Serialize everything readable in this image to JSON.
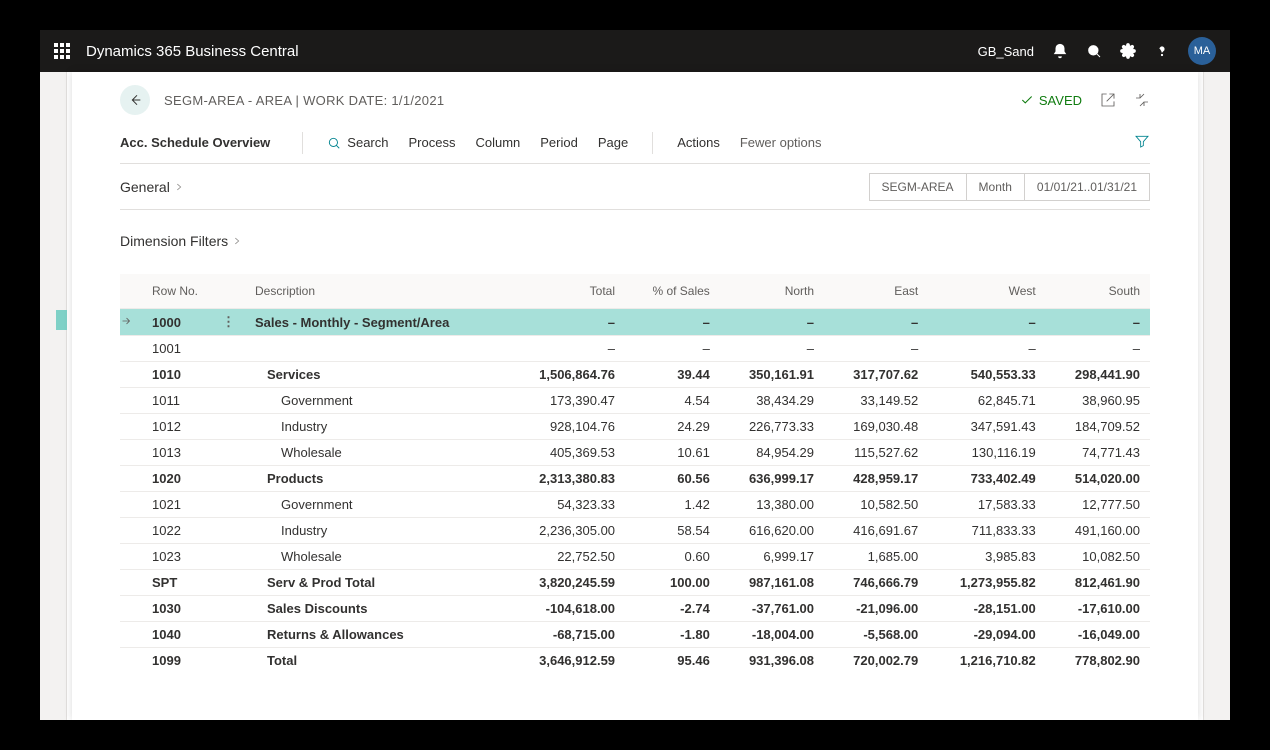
{
  "topbar": {
    "app_name": "Dynamics 365 Business Central",
    "tenant": "GB_Sand",
    "avatar_initials": "MA"
  },
  "page": {
    "title": "SEGM-AREA - AREA | WORK DATE: 1/1/2021",
    "saved_label": "SAVED"
  },
  "toolbar": {
    "title": "Acc. Schedule Overview",
    "search": "Search",
    "process": "Process",
    "column": "Column",
    "period": "Period",
    "page": "Page",
    "actions": "Actions",
    "fewer": "Fewer options"
  },
  "sections": {
    "general": "General",
    "dimension_filters": "Dimension Filters"
  },
  "chips": {
    "segm": "SEGM-AREA",
    "period": "Month",
    "range": "01/01/21..01/31/21"
  },
  "table": {
    "headers": {
      "rowno": "Row No.",
      "desc": "Description",
      "total": "Total",
      "pct": "% of Sales",
      "north": "North",
      "east": "East",
      "west": "West",
      "south": "South"
    },
    "rows": [
      {
        "rowno": "1000",
        "desc": "Sales - Monthly - Segment/Area",
        "total": "–",
        "pct": "–",
        "north": "–",
        "east": "–",
        "west": "–",
        "south": "–",
        "bold": true,
        "indent": 0,
        "selected": true,
        "arrow": true
      },
      {
        "rowno": "1001",
        "desc": "",
        "total": "–",
        "pct": "–",
        "north": "–",
        "east": "–",
        "west": "–",
        "south": "–",
        "bold": false,
        "indent": 0
      },
      {
        "rowno": "1010",
        "desc": "Services",
        "total": "1,506,864.76",
        "pct": "39.44",
        "north": "350,161.91",
        "east": "317,707.62",
        "west": "540,553.33",
        "south": "298,441.90",
        "bold": true,
        "indent": 1
      },
      {
        "rowno": "1011",
        "desc": "Government",
        "total": "173,390.47",
        "pct": "4.54",
        "north": "38,434.29",
        "east": "33,149.52",
        "west": "62,845.71",
        "south": "38,960.95",
        "bold": false,
        "indent": 2
      },
      {
        "rowno": "1012",
        "desc": "Industry",
        "total": "928,104.76",
        "pct": "24.29",
        "north": "226,773.33",
        "east": "169,030.48",
        "west": "347,591.43",
        "south": "184,709.52",
        "bold": false,
        "indent": 2
      },
      {
        "rowno": "1013",
        "desc": "Wholesale",
        "total": "405,369.53",
        "pct": "10.61",
        "north": "84,954.29",
        "east": "115,527.62",
        "west": "130,116.19",
        "south": "74,771.43",
        "bold": false,
        "indent": 2
      },
      {
        "rowno": "1020",
        "desc": "Products",
        "total": "2,313,380.83",
        "pct": "60.56",
        "north": "636,999.17",
        "east": "428,959.17",
        "west": "733,402.49",
        "south": "514,020.00",
        "bold": true,
        "indent": 1
      },
      {
        "rowno": "1021",
        "desc": "Government",
        "total": "54,323.33",
        "pct": "1.42",
        "north": "13,380.00",
        "east": "10,582.50",
        "west": "17,583.33",
        "south": "12,777.50",
        "bold": false,
        "indent": 2
      },
      {
        "rowno": "1022",
        "desc": "Industry",
        "total": "2,236,305.00",
        "pct": "58.54",
        "north": "616,620.00",
        "east": "416,691.67",
        "west": "711,833.33",
        "south": "491,160.00",
        "bold": false,
        "indent": 2
      },
      {
        "rowno": "1023",
        "desc": "Wholesale",
        "total": "22,752.50",
        "pct": "0.60",
        "north": "6,999.17",
        "east": "1,685.00",
        "west": "3,985.83",
        "south": "10,082.50",
        "bold": false,
        "indent": 2
      },
      {
        "rowno": "SPT",
        "desc": "Serv & Prod Total",
        "total": "3,820,245.59",
        "pct": "100.00",
        "north": "987,161.08",
        "east": "746,666.79",
        "west": "1,273,955.82",
        "south": "812,461.90",
        "bold": true,
        "indent": 1
      },
      {
        "rowno": "1030",
        "desc": "Sales Discounts",
        "total": "-104,618.00",
        "pct": "-2.74",
        "north": "-37,761.00",
        "east": "-21,096.00",
        "west": "-28,151.00",
        "south": "-17,610.00",
        "bold": true,
        "indent": 1
      },
      {
        "rowno": "1040",
        "desc": "Returns & Allowances",
        "total": "-68,715.00",
        "pct": "-1.80",
        "north": "-18,004.00",
        "east": "-5,568.00",
        "west": "-29,094.00",
        "south": "-16,049.00",
        "bold": true,
        "indent": 1
      },
      {
        "rowno": "1099",
        "desc": "Total",
        "total": "3,646,912.59",
        "pct": "95.46",
        "north": "931,396.08",
        "east": "720,002.79",
        "west": "1,216,710.82",
        "south": "778,802.90",
        "bold": true,
        "indent": 1
      }
    ]
  }
}
